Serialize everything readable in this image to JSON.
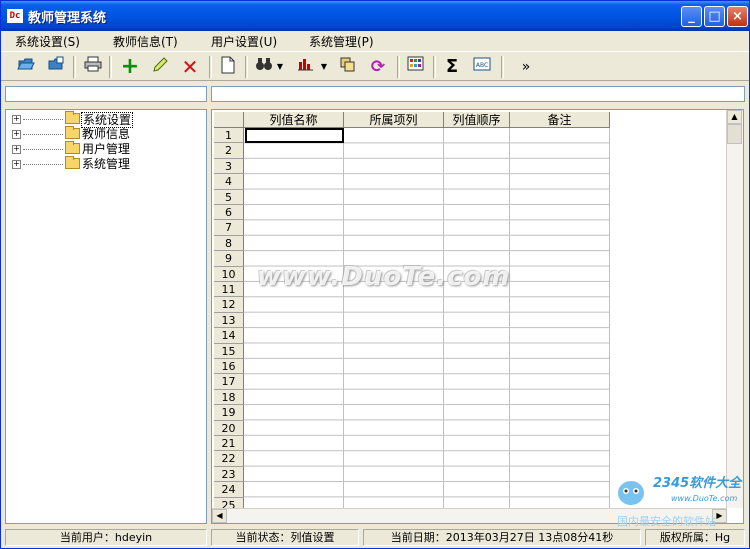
{
  "window": {
    "title": "教师管理系统",
    "app_icon_text": "Dc"
  },
  "menu": [
    "系统设置(S)",
    "教师信息(T)",
    "用户设置(U)",
    "系统管理(P)"
  ],
  "toolbar_icons": [
    "open-folder-icon",
    "save-folder-icon",
    "print-icon",
    "add-icon",
    "edit-pencil-icon",
    "delete-x-icon",
    "new-document-icon",
    "find-binoculars-icon",
    "chart-icon",
    "copy-icon",
    "refresh-icon",
    "grid-icon",
    "sum-icon",
    "abc-icon",
    "more-chevron-icon"
  ],
  "tree": [
    {
      "label": "系统设置",
      "selected": true
    },
    {
      "label": "教师信息",
      "selected": false
    },
    {
      "label": "用户管理",
      "selected": false
    },
    {
      "label": "系统管理",
      "selected": false
    }
  ],
  "grid": {
    "columns": [
      "列值名称",
      "所属项列",
      "列值顺序",
      "备注"
    ],
    "rows": [
      "1",
      "2",
      "3",
      "4",
      "5",
      "6",
      "7",
      "8",
      "9",
      "10",
      "11",
      "12",
      "13",
      "14",
      "15",
      "16",
      "17",
      "18",
      "19",
      "20",
      "21",
      "22",
      "23",
      "24",
      "25"
    ]
  },
  "watermark": "www.DuoTe.com",
  "logo": {
    "brand": "2345软件大全",
    "url": "www.DuoTe.com",
    "tagline": "国内最安全的软件站"
  },
  "status": {
    "user": "当前用户：hdeyin",
    "state": "当前状态：列值设置",
    "date": "当前日期：2013年03月27日  13点08分41秒",
    "copyright": "版权所属：Hg"
  },
  "colors": {
    "title_bar": "#0054e3",
    "close_button": "#c1300e",
    "folder": "#f6d66b"
  }
}
